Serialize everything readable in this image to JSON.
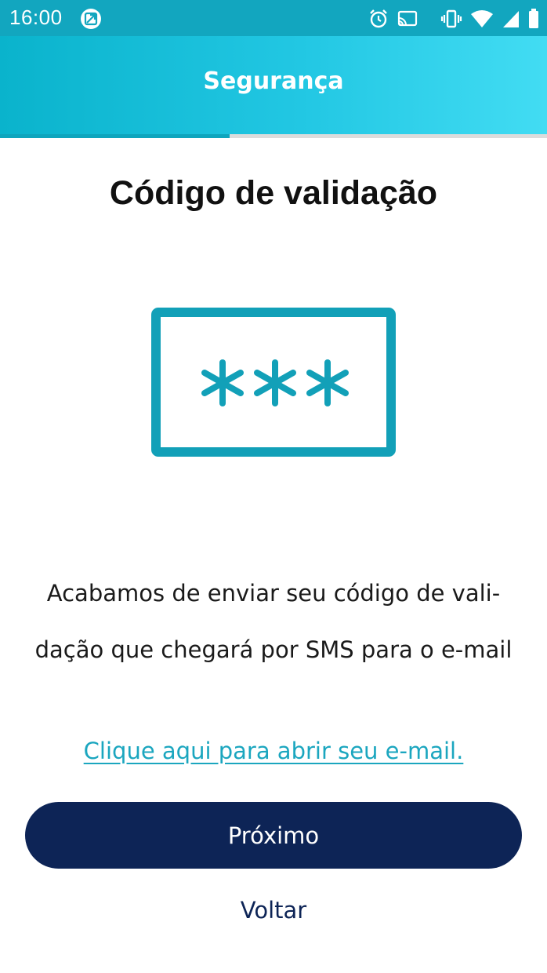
{
  "status_bar": {
    "time": "16:00",
    "icons": [
      "app-notification-icon",
      "alarm-icon",
      "cast-icon",
      "vibrate-icon",
      "wifi-icon",
      "cellular-signal-icon",
      "battery-icon"
    ]
  },
  "header": {
    "title": "Segurança",
    "progress": 0.42
  },
  "main": {
    "title": "Código de validação",
    "illustration_icon": "password-asterisks-icon",
    "message_line1": "Acabamos de enviar seu código de vali-",
    "message_line2": "dação que chegará por SMS para o e-mail",
    "email_link": "Clique aqui para abrir seu e-mail.",
    "next_label": "Próximo",
    "back_label": "Voltar"
  },
  "colors": {
    "accent": "#12a6bf",
    "primary_button": "#0d2456",
    "link": "#1ba6bf"
  }
}
